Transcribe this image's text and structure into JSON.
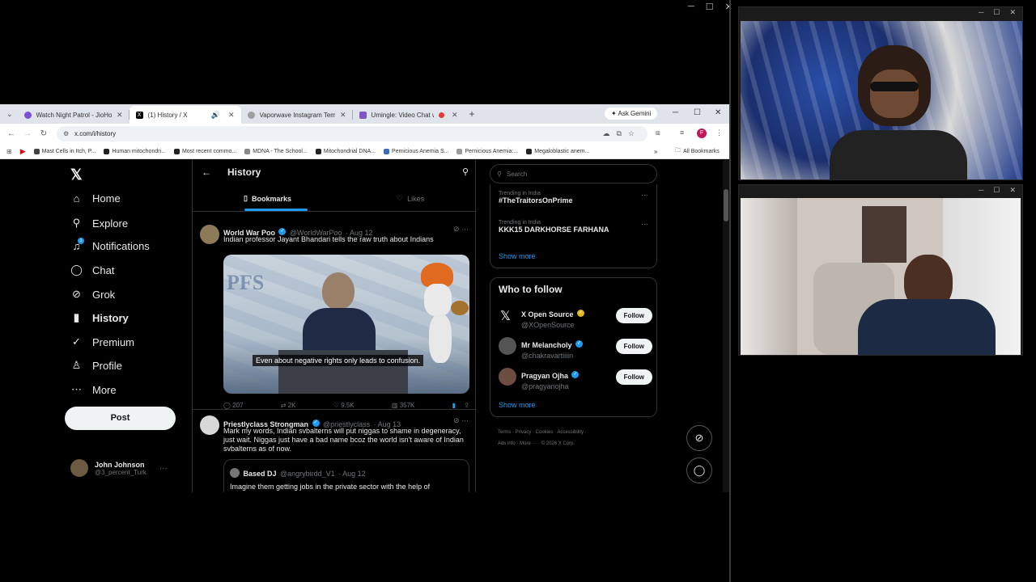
{
  "outer_window": {
    "min": "─",
    "max": "☐",
    "close": "✕"
  },
  "browser": {
    "tabs": [
      {
        "title": "Watch Night Patrol - JioHotstar",
        "icon_color": "#7b4fd6",
        "close": "✕"
      },
      {
        "title": "(1) History / X",
        "icon_color": "#000000",
        "close": "✕"
      },
      {
        "title": "Vaporwave Instagram Template",
        "icon_color": "#9e9e9e",
        "close": "✕"
      },
      {
        "title": "Umingle: Video Chat with S",
        "icon_color": "#7e57c2",
        "close": "✕"
      }
    ],
    "new_tab": "+",
    "ask_gemini": "Ask Gemini",
    "window": {
      "min": "─",
      "max": "☐",
      "close": "✕"
    },
    "url": "x.com/i/history",
    "bookmarks": [
      {
        "label": "Mast Cells in Itch, P...",
        "color": "#444"
      },
      {
        "label": "Human mitochondri...",
        "color": "#222"
      },
      {
        "label": "Most recent commo...",
        "color": "#222"
      },
      {
        "label": "MDNA - The School...",
        "color": "#888"
      },
      {
        "label": "Mitochondrial DNA...",
        "color": "#222"
      },
      {
        "label": "Pernicious Anemia S...",
        "color": "#3b6db4"
      },
      {
        "label": "Pernicious Anemia:...",
        "color": "#999"
      },
      {
        "label": "Megaloblastic anem...",
        "color": "#222"
      }
    ],
    "all_bookmarks": "All Bookmarks"
  },
  "x": {
    "nav": [
      {
        "label": "Home",
        "icon": "⌂"
      },
      {
        "label": "Explore",
        "icon": "⚲"
      },
      {
        "label": "Notifications",
        "icon": "🔔"
      },
      {
        "label": "Chat",
        "icon": "◯"
      },
      {
        "label": "Grok",
        "icon": "⊘"
      },
      {
        "label": "History",
        "icon": "▮"
      },
      {
        "label": "Premium",
        "icon": "✓"
      },
      {
        "label": "Profile",
        "icon": "👤"
      },
      {
        "label": "More",
        "icon": "⋯"
      }
    ],
    "notif_count": "1",
    "post_button": "Post",
    "account": {
      "name": "John Johnson",
      "handle": "@3_percent_Turk"
    },
    "header": {
      "title": "History",
      "tab_bookmarks": "Bookmarks",
      "tab_likes": "Likes"
    },
    "tweets": [
      {
        "name": "World War Poo",
        "handle": "@WorldWarPoo",
        "date": "· Aug 12",
        "text": "Indian professor Jayant Bhandari tells the raw truth about Indians",
        "caption": "Even about negative rights only leads to confusion.",
        "replies": "207",
        "reposts": "2K",
        "likes": "9.5K",
        "views": "357K"
      },
      {
        "name": "Priestlyclass Strongman",
        "handle": "@priestlyclass",
        "date": "· Aug 13",
        "text": "Mark my words, Indian svbalterns will put niggas to shame in degeneracy, just wait. Niggas just have a bad name bcoz the world isn't aware of Indian svbalterns as of now.",
        "quote_name": "Based DJ",
        "quote_handle": "@angrybirdd_V1",
        "quote_date": "· Aug 12",
        "quote_text": "Imagine them getting jobs in the private sector with the help of"
      }
    ],
    "search_placeholder": "Search",
    "trends": [
      {
        "sub": "Trending in India",
        "title": "#TheTraitorsOnPrime"
      },
      {
        "sub": "Trending in India",
        "title": "KKK15 DARKHORSE FARHANA"
      }
    ],
    "show_more": "Show more",
    "who_to_follow": {
      "title": "Who to follow",
      "accounts": [
        {
          "name": "X Open Source",
          "handle": "@XOpenSource",
          "button": "Follow"
        },
        {
          "name": "Mr Melancholy",
          "handle": "@chakravartiiiin",
          "button": "Follow"
        },
        {
          "name": "Pragyan Ojha",
          "handle": "@pragyanojha",
          "button": "Follow"
        }
      ],
      "show_more": "Show more"
    },
    "footer_line1": "Terms  ·  Privacy  ·  Cookies  ·  Accessibility  ·",
    "footer_line2": "Ads info  ·  More ···  ·  © 2026 X Corp."
  },
  "panes": {
    "min": "─",
    "max": "☐",
    "close": "✕"
  },
  "colors": {
    "accent": "#1d9bf0",
    "bg": "#000000",
    "border": "#2f3336",
    "muted": "#71767b"
  }
}
